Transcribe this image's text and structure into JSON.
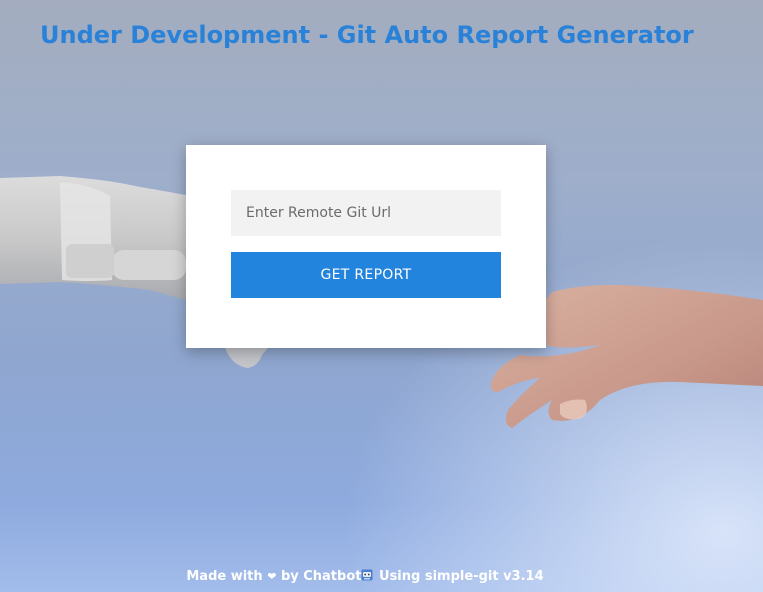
{
  "header": {
    "title": "Under Development - Git Auto Report Generator"
  },
  "form": {
    "url_placeholder": "Enter Remote Git Url",
    "url_value": "",
    "submit_label": "GET REPORT"
  },
  "footer": {
    "made_with": "Made with",
    "heart": "❤",
    "by": "by Chatbot",
    "robot_icon": "robot-icon",
    "using": "Using simple-git v3.14"
  },
  "colors": {
    "accent": "#2384dd",
    "title": "#2a82d8",
    "card": "#ffffff",
    "input_bg": "#f2f2f2"
  }
}
